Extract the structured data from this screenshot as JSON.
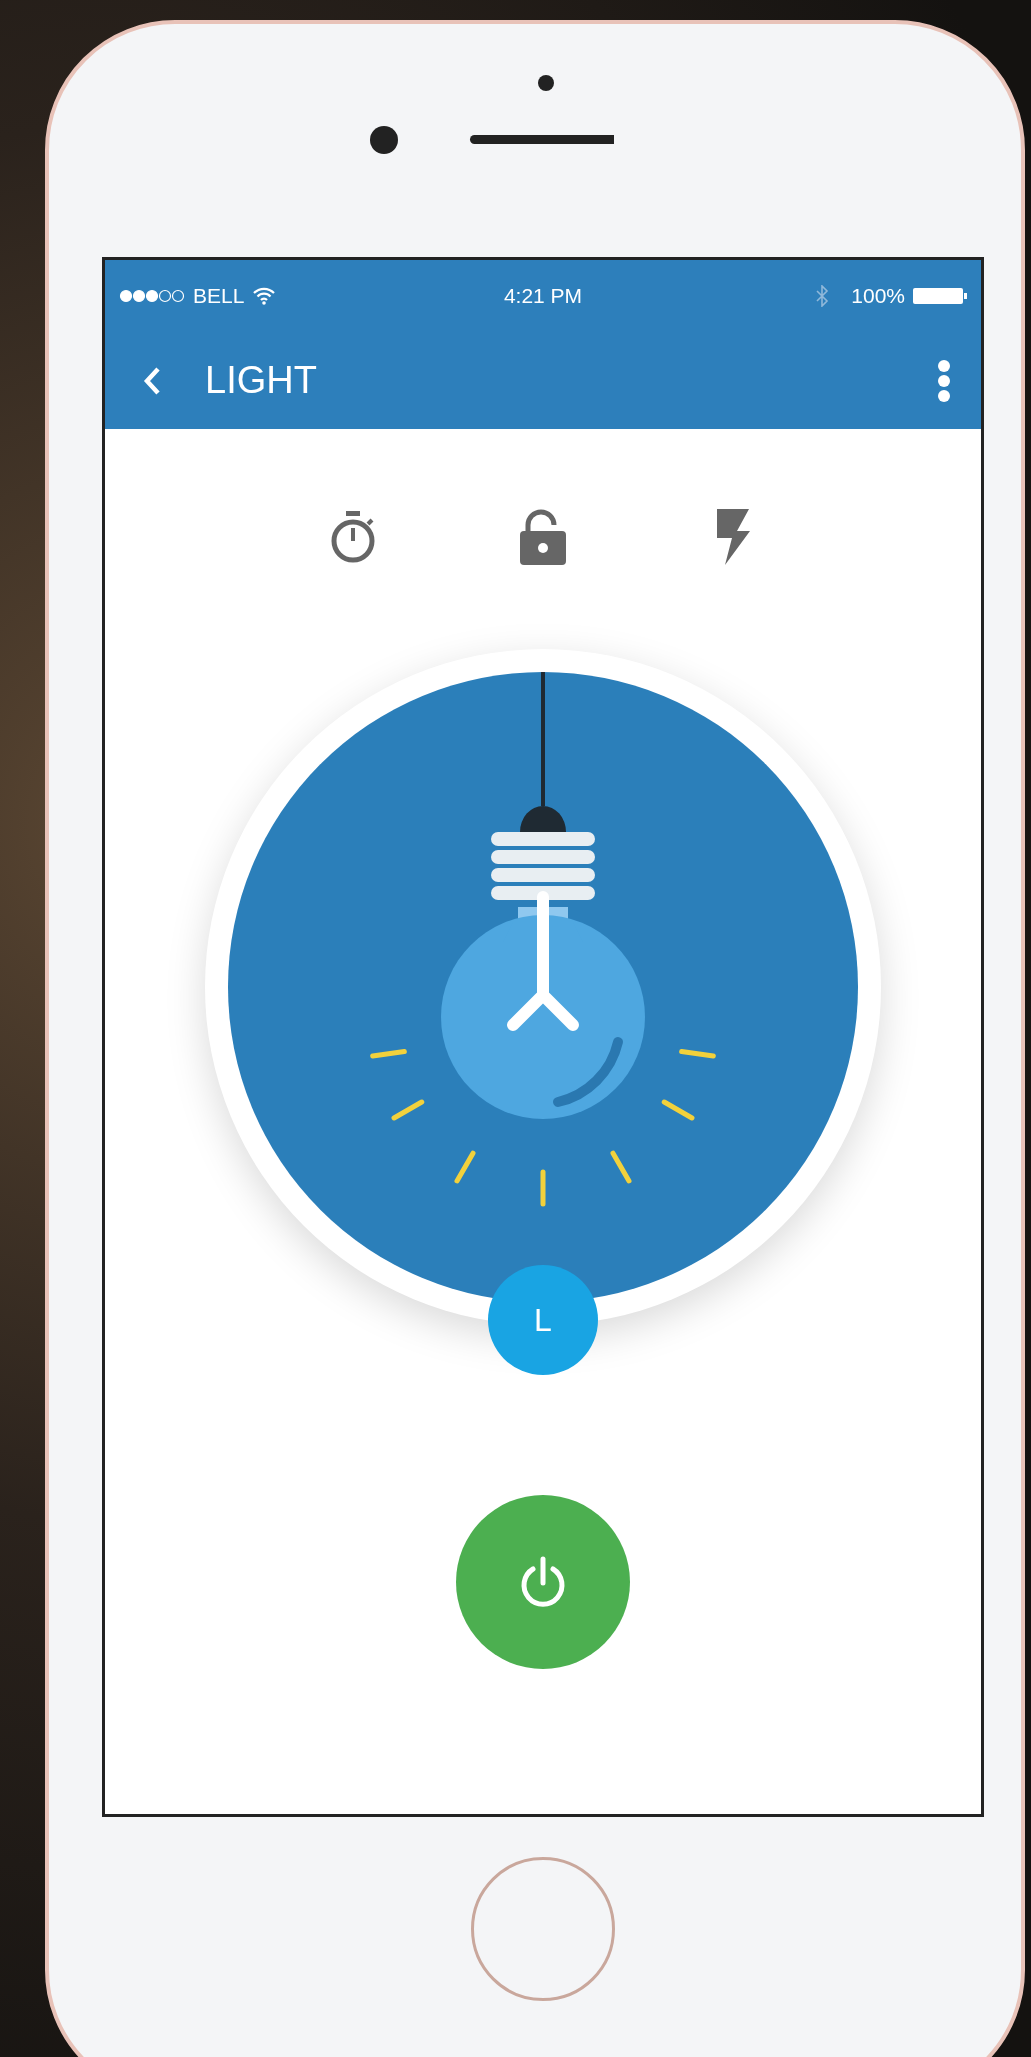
{
  "status_bar": {
    "carrier": "BELL",
    "time": "4:21 PM",
    "battery": "100%"
  },
  "header": {
    "title": "LIGHT"
  },
  "light": {
    "on": true,
    "badge": "L"
  },
  "power_button": {
    "on": true
  }
}
